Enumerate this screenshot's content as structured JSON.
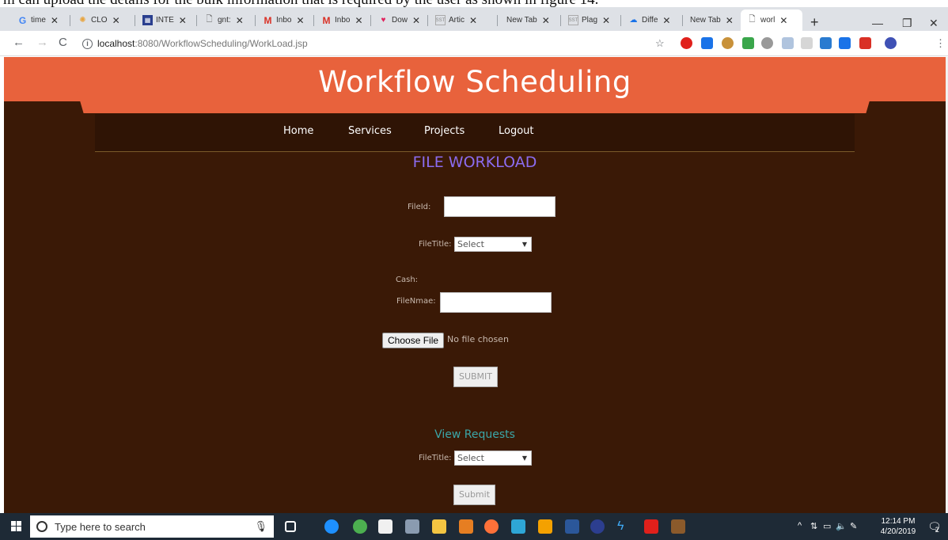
{
  "caption": "m can upload the details for the bulk information that is required by the user as shown in figure 14.",
  "tabs": [
    {
      "label": "time",
      "icon": "google-icon",
      "color": "#4285f4"
    },
    {
      "label": "CLO",
      "icon": "colorful-logo-icon",
      "color": "#e8a33c"
    },
    {
      "label": "INTE",
      "icon": "grid-icon",
      "color": "#2a3f8f"
    },
    {
      "label": "gnt:",
      "icon": "document-icon",
      "color": "#555555"
    },
    {
      "label": "Inbo",
      "icon": "gmail-icon",
      "color": "#d93025"
    },
    {
      "label": "Inbo",
      "icon": "gmail-icon",
      "color": "#d93025"
    },
    {
      "label": "Dow",
      "icon": "heart-icon",
      "color": "#e0245e"
    },
    {
      "label": "Artic",
      "icon": "sst-icon",
      "color": "#888888"
    },
    {
      "label": "New Tab",
      "icon": "",
      "color": ""
    },
    {
      "label": "Plag",
      "icon": "sst-icon",
      "color": "#888888"
    },
    {
      "label": "Diffe",
      "icon": "cloud-icon",
      "color": "#1a73e8"
    },
    {
      "label": "New Tab",
      "icon": "",
      "color": ""
    },
    {
      "label": "worl",
      "icon": "document-icon",
      "color": "#555555"
    }
  ],
  "address": {
    "host": "localhost",
    "path": ":8080/WorkflowScheduling/WorkLoad.jsp"
  },
  "site": {
    "title": "Workflow Scheduling",
    "menu": [
      "Home",
      "Services",
      "Projects",
      "Logout"
    ],
    "heading": "FILE WORKLOAD",
    "form": {
      "fileid_label": "FileId:",
      "filetitle_label": "FileTitle:",
      "filetitle_value": "Select",
      "cash_label": "Cash:",
      "filename_label": "FileNmae:",
      "choose_file": "Choose File",
      "no_file": "No file chosen",
      "submit": "SUBMIT"
    },
    "requests": {
      "heading": "View Requests",
      "filetitle_label": "FileTitle:",
      "filetitle_value": "Select",
      "submit": "Submit"
    }
  },
  "taskbar": {
    "search_placeholder": "Type here to search",
    "time": "12:14 PM",
    "date": "4/20/2019",
    "notifications": "2"
  },
  "colors": {
    "banner": "#e8623c",
    "page_bg": "#3a1906",
    "heading": "#8b6cf0",
    "subheading": "#3aa6a8"
  }
}
